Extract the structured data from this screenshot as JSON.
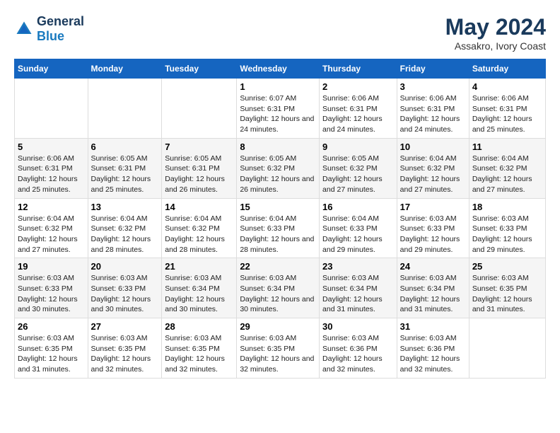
{
  "header": {
    "logo_line1": "General",
    "logo_line2": "Blue",
    "month_year": "May 2024",
    "location": "Assakro, Ivory Coast"
  },
  "days_of_week": [
    "Sunday",
    "Monday",
    "Tuesday",
    "Wednesday",
    "Thursday",
    "Friday",
    "Saturday"
  ],
  "weeks": [
    [
      {
        "day": null
      },
      {
        "day": null
      },
      {
        "day": null
      },
      {
        "day": 1,
        "sunrise": "6:07 AM",
        "sunset": "6:31 PM",
        "daylight": "12 hours and 24 minutes."
      },
      {
        "day": 2,
        "sunrise": "6:06 AM",
        "sunset": "6:31 PM",
        "daylight": "12 hours and 24 minutes."
      },
      {
        "day": 3,
        "sunrise": "6:06 AM",
        "sunset": "6:31 PM",
        "daylight": "12 hours and 24 minutes."
      },
      {
        "day": 4,
        "sunrise": "6:06 AM",
        "sunset": "6:31 PM",
        "daylight": "12 hours and 25 minutes."
      }
    ],
    [
      {
        "day": 5,
        "sunrise": "6:06 AM",
        "sunset": "6:31 PM",
        "daylight": "12 hours and 25 minutes."
      },
      {
        "day": 6,
        "sunrise": "6:05 AM",
        "sunset": "6:31 PM",
        "daylight": "12 hours and 25 minutes."
      },
      {
        "day": 7,
        "sunrise": "6:05 AM",
        "sunset": "6:31 PM",
        "daylight": "12 hours and 26 minutes."
      },
      {
        "day": 8,
        "sunrise": "6:05 AM",
        "sunset": "6:32 PM",
        "daylight": "12 hours and 26 minutes."
      },
      {
        "day": 9,
        "sunrise": "6:05 AM",
        "sunset": "6:32 PM",
        "daylight": "12 hours and 27 minutes."
      },
      {
        "day": 10,
        "sunrise": "6:04 AM",
        "sunset": "6:32 PM",
        "daylight": "12 hours and 27 minutes."
      },
      {
        "day": 11,
        "sunrise": "6:04 AM",
        "sunset": "6:32 PM",
        "daylight": "12 hours and 27 minutes."
      }
    ],
    [
      {
        "day": 12,
        "sunrise": "6:04 AM",
        "sunset": "6:32 PM",
        "daylight": "12 hours and 27 minutes."
      },
      {
        "day": 13,
        "sunrise": "6:04 AM",
        "sunset": "6:32 PM",
        "daylight": "12 hours and 28 minutes."
      },
      {
        "day": 14,
        "sunrise": "6:04 AM",
        "sunset": "6:32 PM",
        "daylight": "12 hours and 28 minutes."
      },
      {
        "day": 15,
        "sunrise": "6:04 AM",
        "sunset": "6:33 PM",
        "daylight": "12 hours and 28 minutes."
      },
      {
        "day": 16,
        "sunrise": "6:04 AM",
        "sunset": "6:33 PM",
        "daylight": "12 hours and 29 minutes."
      },
      {
        "day": 17,
        "sunrise": "6:03 AM",
        "sunset": "6:33 PM",
        "daylight": "12 hours and 29 minutes."
      },
      {
        "day": 18,
        "sunrise": "6:03 AM",
        "sunset": "6:33 PM",
        "daylight": "12 hours and 29 minutes."
      }
    ],
    [
      {
        "day": 19,
        "sunrise": "6:03 AM",
        "sunset": "6:33 PM",
        "daylight": "12 hours and 30 minutes."
      },
      {
        "day": 20,
        "sunrise": "6:03 AM",
        "sunset": "6:33 PM",
        "daylight": "12 hours and 30 minutes."
      },
      {
        "day": 21,
        "sunrise": "6:03 AM",
        "sunset": "6:34 PM",
        "daylight": "12 hours and 30 minutes."
      },
      {
        "day": 22,
        "sunrise": "6:03 AM",
        "sunset": "6:34 PM",
        "daylight": "12 hours and 30 minutes."
      },
      {
        "day": 23,
        "sunrise": "6:03 AM",
        "sunset": "6:34 PM",
        "daylight": "12 hours and 31 minutes."
      },
      {
        "day": 24,
        "sunrise": "6:03 AM",
        "sunset": "6:34 PM",
        "daylight": "12 hours and 31 minutes."
      },
      {
        "day": 25,
        "sunrise": "6:03 AM",
        "sunset": "6:35 PM",
        "daylight": "12 hours and 31 minutes."
      }
    ],
    [
      {
        "day": 26,
        "sunrise": "6:03 AM",
        "sunset": "6:35 PM",
        "daylight": "12 hours and 31 minutes."
      },
      {
        "day": 27,
        "sunrise": "6:03 AM",
        "sunset": "6:35 PM",
        "daylight": "12 hours and 32 minutes."
      },
      {
        "day": 28,
        "sunrise": "6:03 AM",
        "sunset": "6:35 PM",
        "daylight": "12 hours and 32 minutes."
      },
      {
        "day": 29,
        "sunrise": "6:03 AM",
        "sunset": "6:35 PM",
        "daylight": "12 hours and 32 minutes."
      },
      {
        "day": 30,
        "sunrise": "6:03 AM",
        "sunset": "6:36 PM",
        "daylight": "12 hours and 32 minutes."
      },
      {
        "day": 31,
        "sunrise": "6:03 AM",
        "sunset": "6:36 PM",
        "daylight": "12 hours and 32 minutes."
      },
      {
        "day": null
      }
    ]
  ]
}
